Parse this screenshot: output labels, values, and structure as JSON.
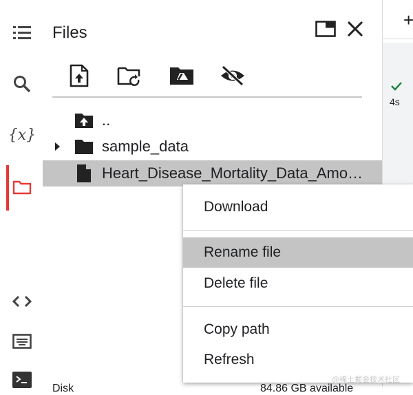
{
  "rail": {
    "items": [
      {
        "icon": "table-of-contents-icon"
      },
      {
        "icon": "search-icon"
      },
      {
        "icon": "variables-icon",
        "label": "{x}"
      },
      {
        "icon": "folder-icon",
        "active": true
      },
      {
        "icon": "code-snippets-icon"
      },
      {
        "icon": "command-palette-icon"
      },
      {
        "icon": "terminal-icon"
      }
    ],
    "active_color": "#e53935"
  },
  "files_panel": {
    "title": "Files",
    "header_buttons": [
      "open-in-tab-icon",
      "close-icon"
    ],
    "toolbar": [
      "upload-file-icon",
      "refresh-folder-icon",
      "mount-drive-icon",
      "hide-files-icon"
    ],
    "tree": [
      {
        "label": "..",
        "icon": "parent-folder-icon"
      },
      {
        "label": "sample_data",
        "icon": "folder-icon",
        "expandable": true
      },
      {
        "label": "Heart_Disease_Mortality_Data_Amo…",
        "icon": "file-icon",
        "selected": true
      }
    ],
    "disk_label": "Disk",
    "disk_value": "84.86 GB available"
  },
  "notebook_strip": {
    "add_label": "+",
    "status_icon": "check-icon",
    "exec_time": "4s"
  },
  "context_menu": {
    "groups": [
      [
        "Download"
      ],
      [
        "Rename file",
        "Delete file"
      ],
      [
        "Copy path",
        "Refresh"
      ]
    ],
    "hovered": "Rename file"
  },
  "watermark": "@稀土掘金技术社区"
}
